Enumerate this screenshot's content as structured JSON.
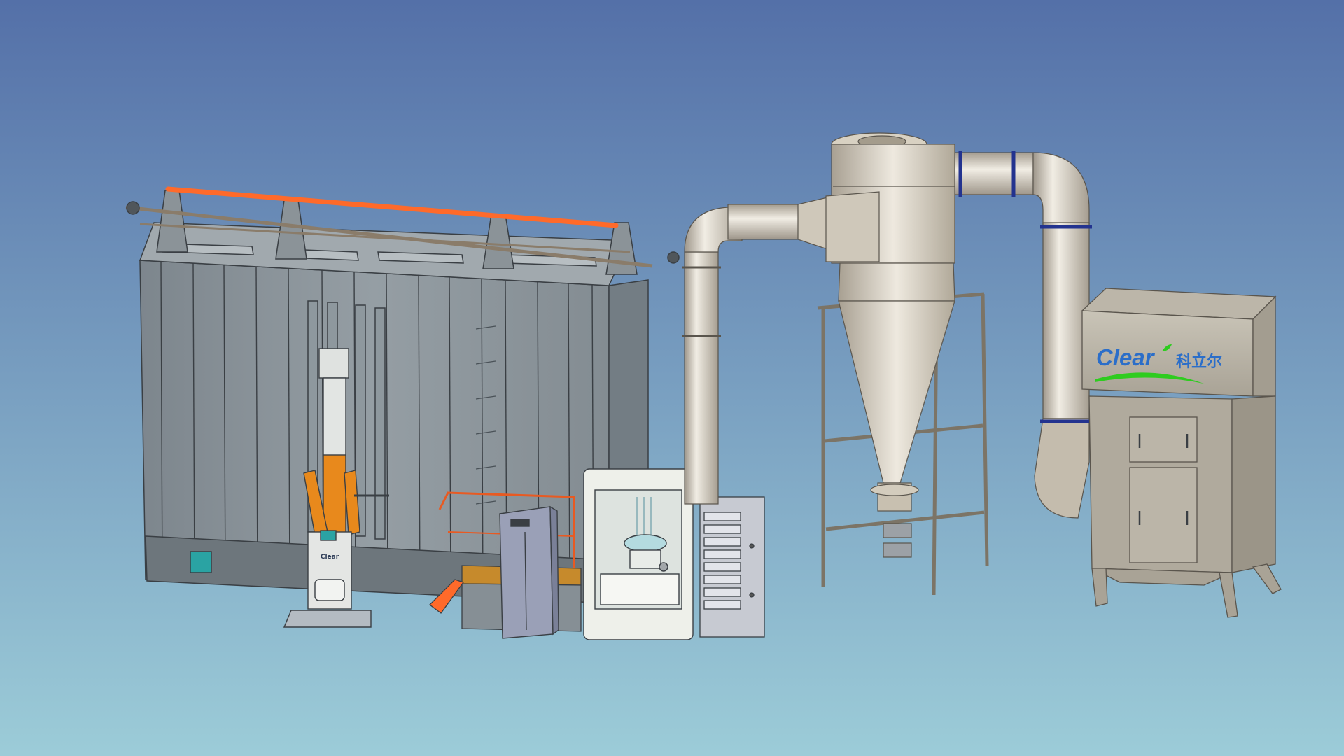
{
  "scene": {
    "background_top": "#5470a8",
    "background_bottom": "#9cccd8",
    "colors": {
      "booth_panel": "#8e989e",
      "booth_dark": "#737d84",
      "line": "#3a3f44",
      "rail_orange": "#ff6a2a",
      "reciprocator_orange": "#e8891c",
      "metal_light": "#e4dfd4",
      "metal_mid": "#c2baa9",
      "metal_dark": "#8f8778",
      "flange_blue": "#23338f",
      "brand_blue": "#2b6ec9",
      "brand_green": "#2ecc1f",
      "indicator_teal": "#2aa3a3"
    }
  },
  "brand": {
    "latin": "Clear",
    "cjk": "科立尔",
    "reg_mark": "®"
  },
  "reciprocator": {
    "plate_text": "Clear"
  },
  "icons": {
    "brand_leaf": "leaf-icon",
    "brand_swoosh": "swoosh-icon"
  }
}
